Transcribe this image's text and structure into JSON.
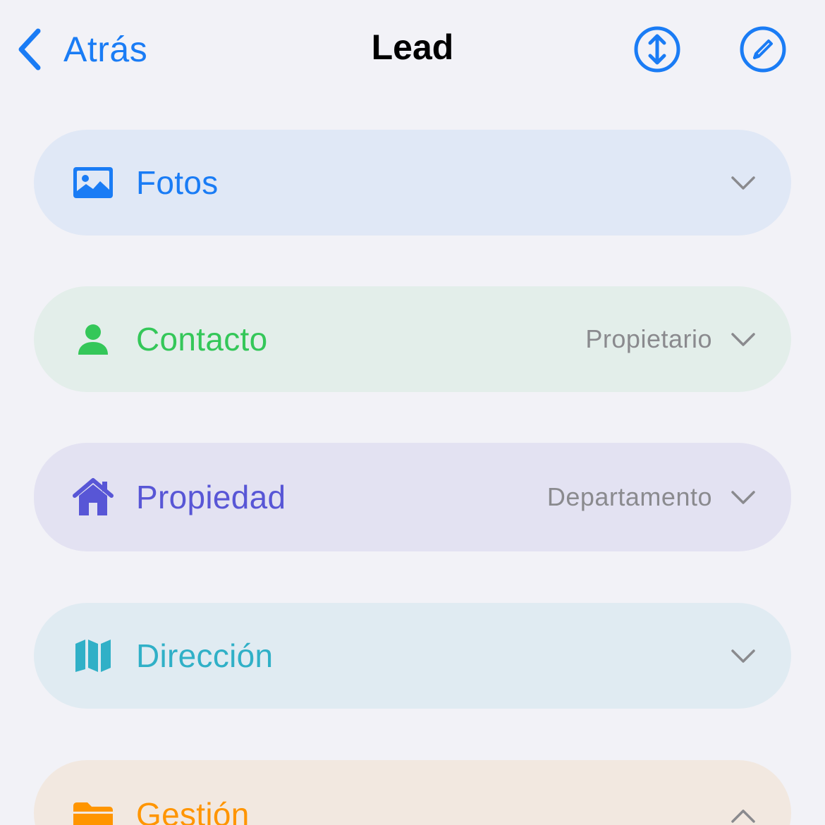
{
  "navbar": {
    "back_label": "Atrás",
    "title": "Lead",
    "icons": {
      "reorder": "up-down-arrows-icon",
      "edit": "pencil-icon"
    }
  },
  "colors": {
    "background": "#F2F2F7",
    "accent_blue": "#1A7CF5",
    "chevron_gray": "#8A8A8E"
  },
  "sections": [
    {
      "title": "Fotos",
      "value": "",
      "icon": "photo-icon",
      "color": "#1A7CF5",
      "bg": "#E0E8F6",
      "expanded": false
    },
    {
      "title": "Contacto",
      "value": "Propietario",
      "icon": "person-icon",
      "color": "#34C759",
      "bg": "#E3EEEA",
      "expanded": false
    },
    {
      "title": "Propiedad",
      "value": "Departamento",
      "icon": "house-icon",
      "color": "#5856D6",
      "bg": "#E3E2F2",
      "expanded": false
    },
    {
      "title": "Dirección",
      "value": "",
      "icon": "map-icon",
      "color": "#30B0C7",
      "bg": "#E0EBF2",
      "expanded": false
    },
    {
      "title": "Gestión",
      "value": "",
      "icon": "folder-icon",
      "color": "#FF9500",
      "bg": "#F2E8E0",
      "expanded": true
    }
  ]
}
